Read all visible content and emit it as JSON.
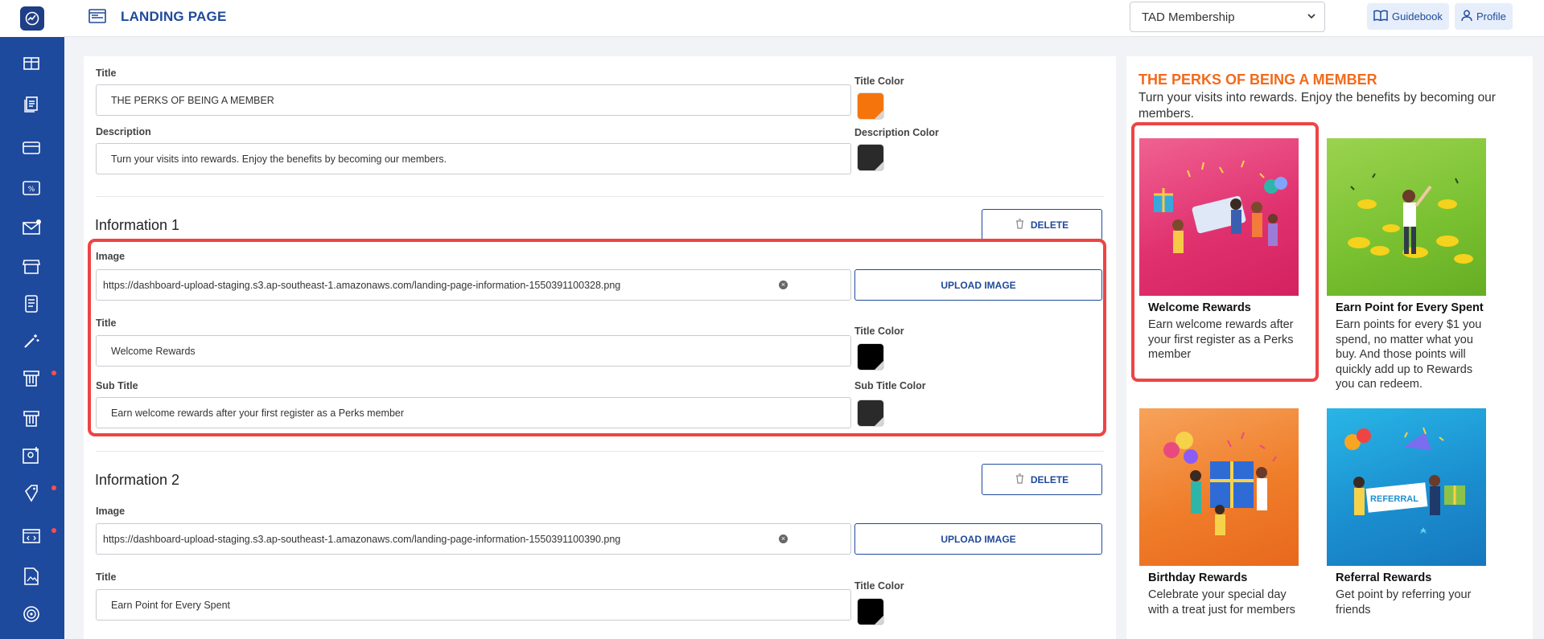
{
  "header": {
    "title": "LANDING PAGE",
    "membership_select": "TAD Membership",
    "guidebook_label": "Guidebook",
    "profile_label": "Profile"
  },
  "form": {
    "title_label": "Title",
    "title_value": "THE PERKS OF BEING A MEMBER",
    "title_color_label": "Title Color",
    "title_color": "#f5750c",
    "description_label": "Description",
    "description_value": "Turn your visits into rewards. Enjoy the benefits by becoming our members.",
    "description_color_label": "Description Color",
    "description_color": "#2a2a2a",
    "info1": {
      "heading": "Information 1",
      "delete_label": "DELETE",
      "image_label": "Image",
      "image_url": "https://dashboard-upload-staging.s3.ap-southeast-1.amazonaws.com/landing-page-information-1550391100328.png",
      "upload_label": "UPLOAD IMAGE",
      "title_label": "Title",
      "title_value": "Welcome Rewards",
      "title_color_label": "Title Color",
      "title_color": "#000000",
      "subtitle_label": "Sub Title",
      "subtitle_value": "Earn welcome rewards after your first register as a Perks member",
      "subtitle_color_label": "Sub Title Color",
      "subtitle_color": "#2a2a2a"
    },
    "info2": {
      "heading": "Information 2",
      "delete_label": "DELETE",
      "image_label": "Image",
      "image_url": "https://dashboard-upload-staging.s3.ap-southeast-1.amazonaws.com/landing-page-information-1550391100390.png",
      "upload_label": "UPLOAD IMAGE",
      "title_label": "Title",
      "title_value": "Earn Point for Every Spent",
      "title_color_label": "Title Color",
      "title_color": "#000000"
    }
  },
  "preview": {
    "title": "THE PERKS OF BEING A MEMBER",
    "description": "Turn your visits into rewards. Enjoy the benefits by becoming our members.",
    "cards": [
      {
        "title": "Welcome Rewards",
        "text": "Earn welcome rewards after your first register as a Perks member",
        "color": "#e0326f"
      },
      {
        "title": "Earn Point for Every Spent",
        "text": "Earn points for every $1 you spend, no matter what you buy. And those points will quickly add up to Rewards you can redeem.",
        "color": "#7cc336"
      },
      {
        "title": "Birthday Rewards",
        "text": "Celebrate your special day with a treat just for members",
        "color": "#ef7d2a"
      },
      {
        "title": "Referral Rewards",
        "text": "Get point by referring your friends",
        "color": "#1b8fd0"
      }
    ],
    "referral_sign": "REFERRAL"
  },
  "colors": {
    "sidebar": "#1e4a9e",
    "accent": "#1f4a9a",
    "highlight": "#ee4444",
    "preview_title": "#f26a1b"
  }
}
